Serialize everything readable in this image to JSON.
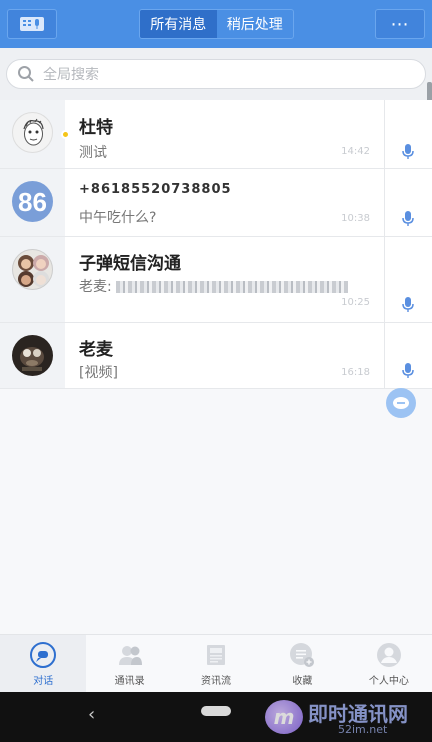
{
  "header": {
    "left_icon": "contacts-card-icon",
    "tabs": [
      {
        "label": "所有消息",
        "active": true
      },
      {
        "label": "稍后处理",
        "active": false
      }
    ],
    "more_icon": "⋯"
  },
  "search": {
    "placeholder": "全局搜索"
  },
  "conversations": [
    {
      "name": "杜特",
      "preview": "测试",
      "time": "14:42",
      "unread_dot": true,
      "avatar": "sketch-face-avatar"
    },
    {
      "name": "+86185520738805",
      "preview": "中午吃什么?",
      "time": "10:38",
      "unread_dot": false,
      "avatar": "number-86-avatar"
    },
    {
      "name": "子弹短信沟通",
      "preview_prefix": "老麦:",
      "preview": "",
      "time": "10:25",
      "unread_dot": false,
      "avatar": "group-avatar"
    },
    {
      "name": "老麦",
      "preview": "[视频]",
      "time": "16:18",
      "unread_dot": false,
      "avatar": "photo-avatar"
    }
  ],
  "bottom_nav": [
    {
      "label": "对话",
      "icon": "chat-icon",
      "active": true
    },
    {
      "label": "通讯录",
      "icon": "contacts-icon",
      "active": false
    },
    {
      "label": "资讯流",
      "icon": "news-icon",
      "active": false
    },
    {
      "label": "收藏",
      "icon": "favorites-icon",
      "active": false
    },
    {
      "label": "个人中心",
      "icon": "profile-icon",
      "active": false
    }
  ],
  "watermark": {
    "title": "即时通讯网",
    "sub": "52im.net",
    "logo_letter": "m"
  },
  "colors": {
    "header": "#4a8fe4",
    "accent": "#2e6fcf",
    "mic": "#5a8fe0",
    "unread": "#f5c518"
  }
}
